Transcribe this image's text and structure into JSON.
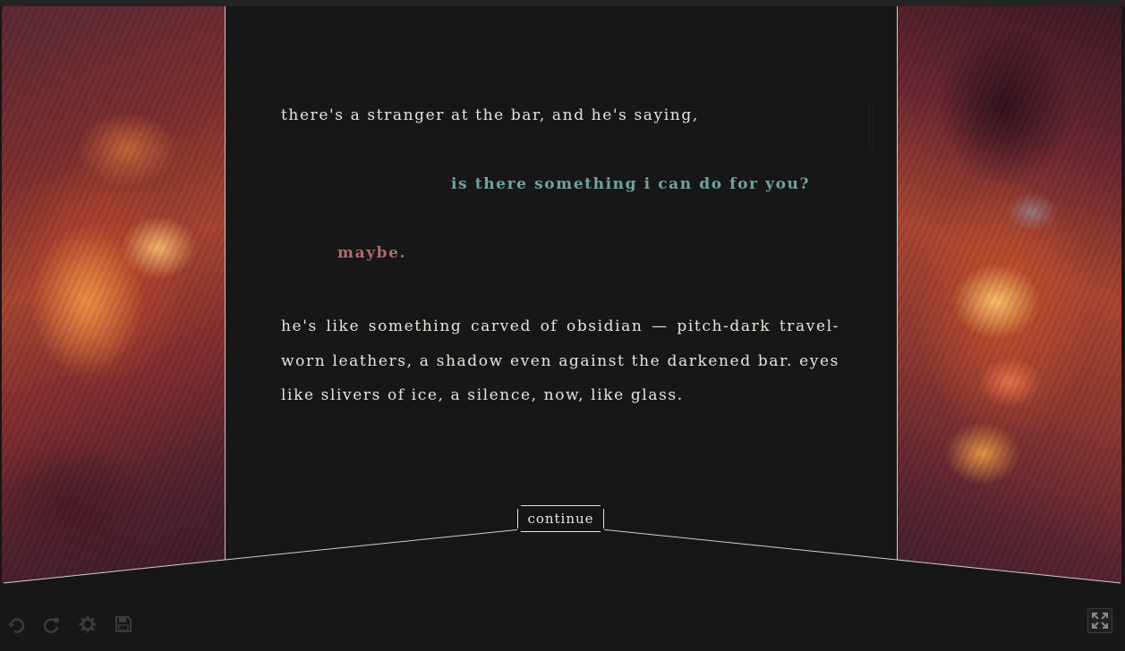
{
  "story": {
    "narration_1": "there's a stranger at the bar, and he's saying,",
    "stranger_line": "is there something i can do for you?",
    "player_line": "maybe.",
    "narration_2": "he's like something carved of obsidian — pitch-dark travel-worn leathers, a shadow even against the darkened bar. eyes like slivers of ice, a silence, now, like glass."
  },
  "controls": {
    "continue_label": "continue"
  },
  "toolbar": {
    "icons": [
      "undo-icon",
      "redo-icon",
      "settings-icon",
      "save-icon"
    ],
    "fullscreen_icon": "fullscreen-icon"
  },
  "colors": {
    "background": "#171717",
    "text": "#e9e4dc",
    "stranger_speech": "#6fa3a3",
    "player_speech": "#b06a6e"
  }
}
